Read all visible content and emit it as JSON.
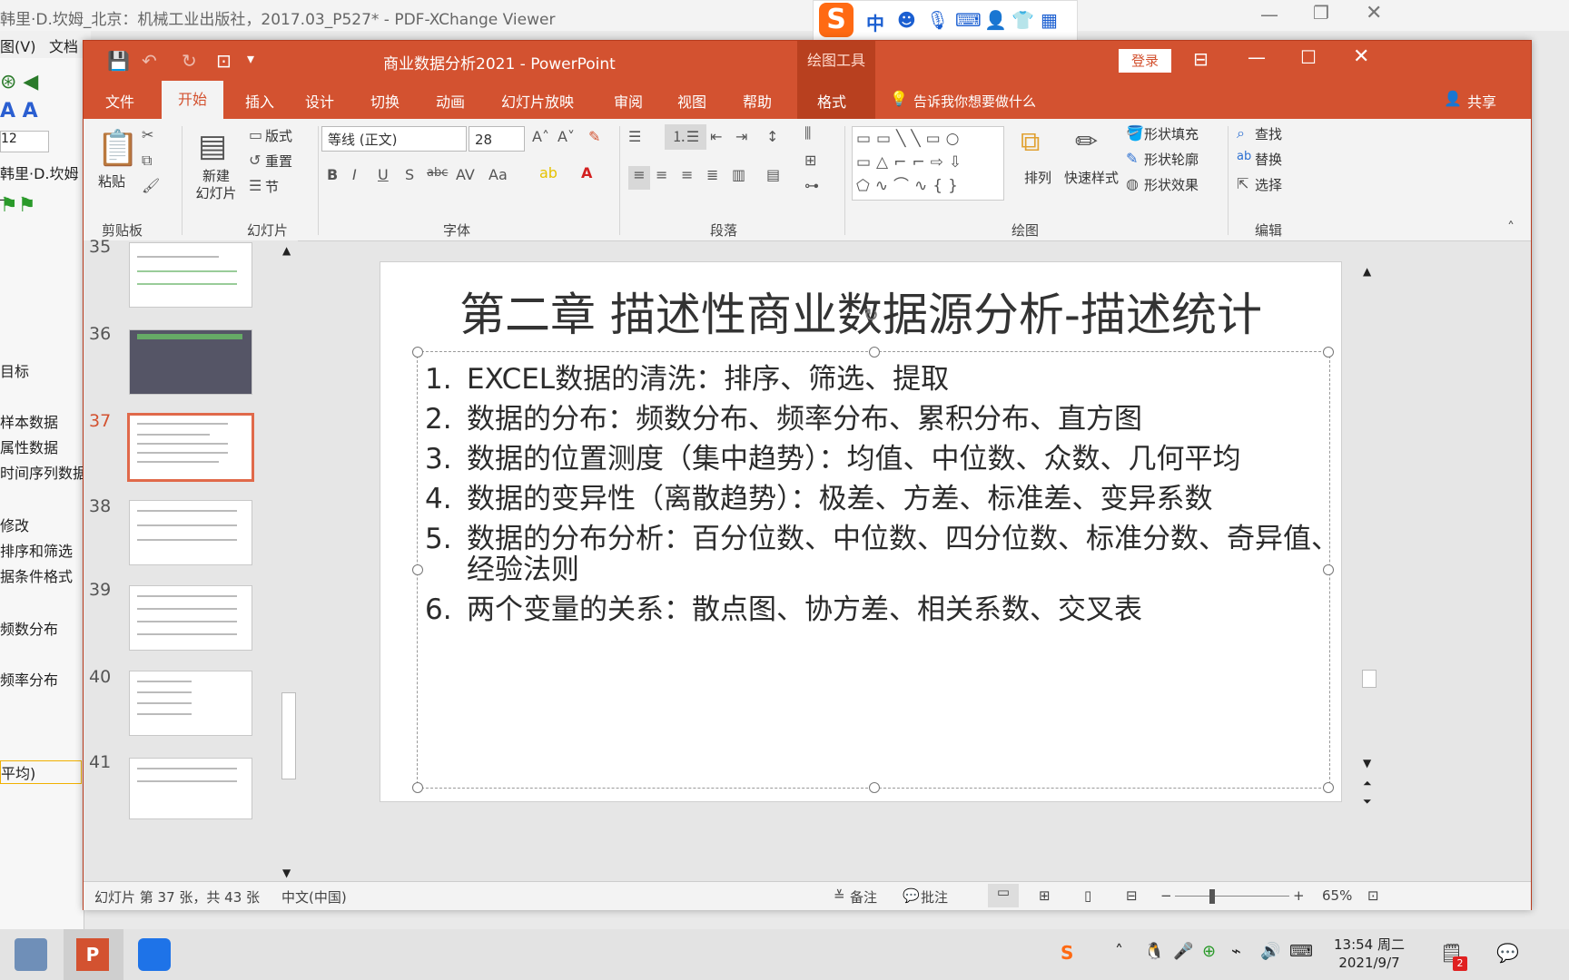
{
  "bg_viewer": {
    "title": "韩里·D.坎姆_北京：机械工业出版社，2017.03_P527* - PDF-XChange Viewer",
    "menu": [
      "图(V)",
      "文档"
    ],
    "zoom": "12",
    "doc_label": "韩里·D.坎姆_",
    "side_items": [
      "目标",
      "样本数据",
      "属性数据",
      "时间序列数据",
      "修改",
      "排序和筛选",
      "据条件格式",
      "频数分布",
      "频率分布",
      "平均)"
    ]
  },
  "ime": {
    "logo": "S",
    "lang": "中"
  },
  "ppt": {
    "title": "商业数据分析2021  -  PowerPoint",
    "context_tool": "绘图工具",
    "login": "登录",
    "tabs": [
      "文件",
      "开始",
      "插入",
      "设计",
      "切换",
      "动画",
      "幻灯片放映",
      "审阅",
      "视图",
      "帮助",
      "格式"
    ],
    "tell_me": "告诉我你想要做什么",
    "share": "共享"
  },
  "ribbon": {
    "clipboard": {
      "paste": "粘贴",
      "label": "剪贴板"
    },
    "slides": {
      "new_slide": "新建\n幻灯片",
      "layout": "版式",
      "reset": "重置",
      "section": "节",
      "label": "幻灯片"
    },
    "font": {
      "name": "等线 (正文)",
      "size": "28",
      "label": "字体",
      "buttons": [
        "B",
        "I",
        "U",
        "S",
        "abc",
        "AV",
        "Aa"
      ]
    },
    "paragraph": {
      "label": "段落"
    },
    "drawing": {
      "arrange": "排列",
      "quick_styles": "快速样式",
      "fill": "形状填充",
      "outline": "形状轮廓",
      "effects": "形状效果",
      "label": "绘图"
    },
    "editing": {
      "find": "查找",
      "replace": "替换",
      "select": "选择",
      "label": "编辑"
    }
  },
  "thumbnails": [
    {
      "num": "35"
    },
    {
      "num": "36"
    },
    {
      "num": "37",
      "selected": true
    },
    {
      "num": "38"
    },
    {
      "num": "39"
    },
    {
      "num": "40"
    },
    {
      "num": "41"
    }
  ],
  "slide": {
    "title": "第二章 描述性商业数据源分析-描述统计",
    "bullets": [
      {
        "n": "1.",
        "text": "EXCEL数据的清洗：排序、筛选、提取"
      },
      {
        "n": "2.",
        "text": "数据的分布：频数分布、频率分布、累积分布、直方图"
      },
      {
        "n": "3.",
        "text": "数据的位置测度（集中趋势）：均值、中位数、众数、几何平均"
      },
      {
        "n": "4.",
        "text": "数据的变异性（离散趋势）：极差、方差、标准差、变异系数"
      },
      {
        "n": "5.",
        "text": "数据的分布分析：百分位数、中位数、四分位数、标准分数、奇异值、",
        "cont": "经验法则"
      },
      {
        "n": "6.",
        "text": "两个变量的关系：散点图、协方差、相关系数、交叉表"
      }
    ]
  },
  "status": {
    "slide_info": "幻灯片 第 37 张，共 43 张",
    "language": "中文(中国)",
    "notes": "备注",
    "comments": "批注",
    "zoom": "65%"
  },
  "taskbar": {
    "time": "13:54 周二",
    "date": "2021/9/7",
    "badge": "2"
  }
}
